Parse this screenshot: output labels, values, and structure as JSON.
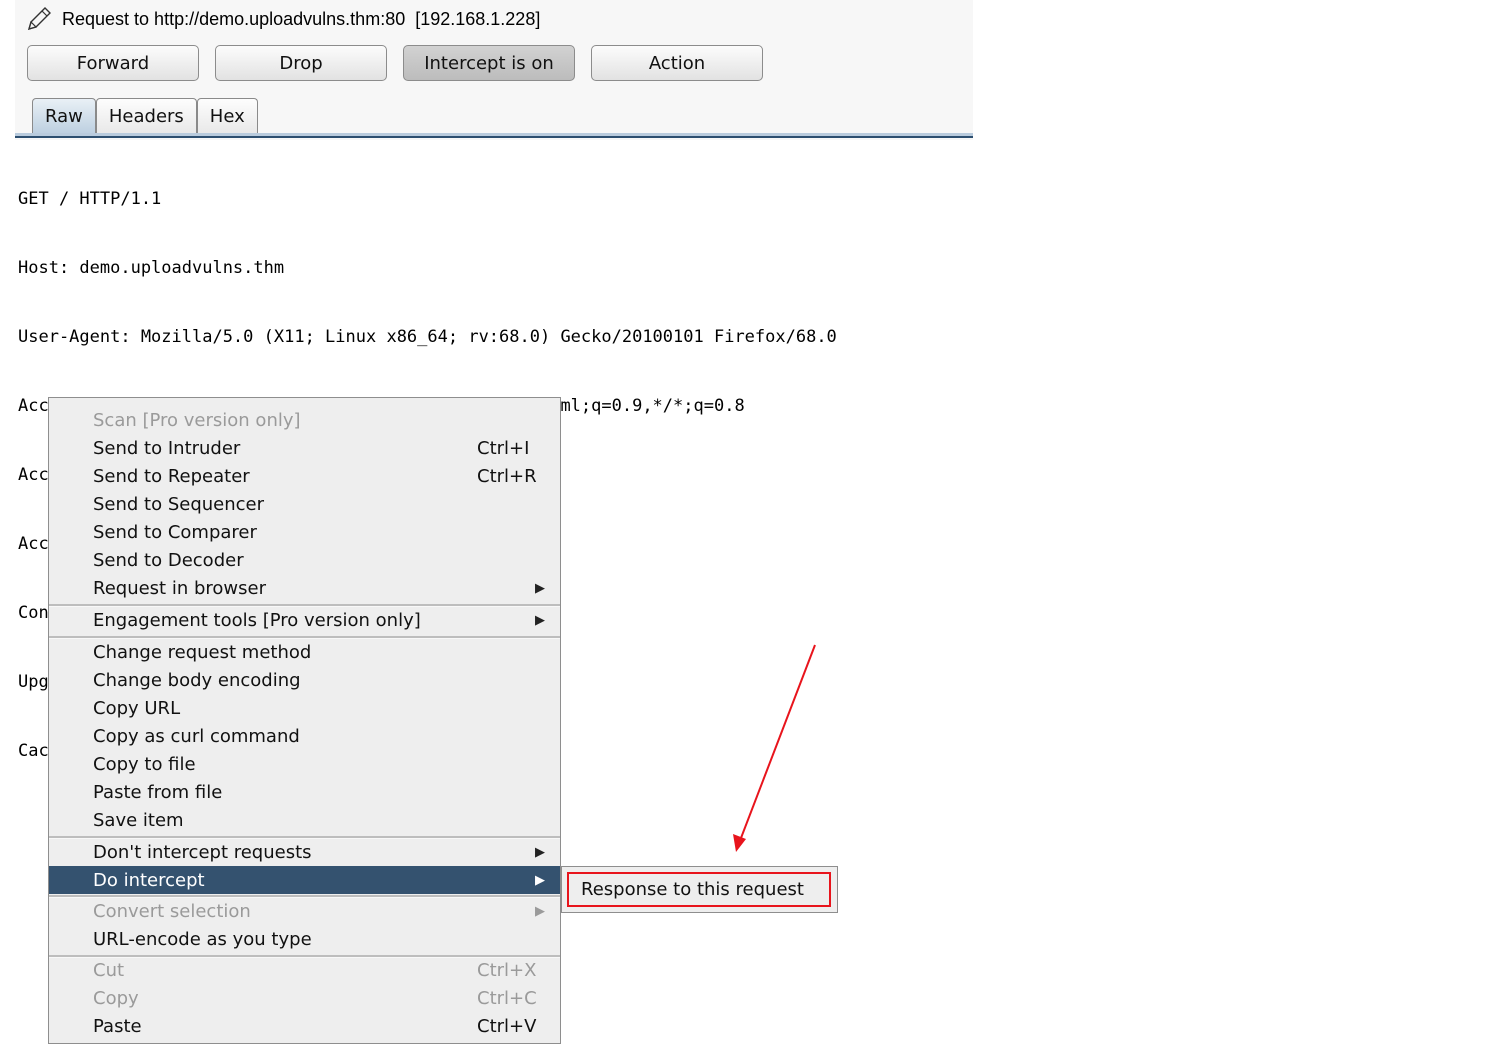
{
  "window": {
    "title": "Request to http://demo.uploadvulns.thm:80  [192.168.1.228]",
    "edit_icon": "pencil-icon"
  },
  "toolbar": {
    "forward": "Forward",
    "drop": "Drop",
    "intercept": "Intercept is on",
    "action": "Action"
  },
  "tabs": [
    {
      "label": "Raw",
      "selected": true
    },
    {
      "label": "Headers"
    },
    {
      "label": "Hex"
    }
  ],
  "request_lines": [
    "GET / HTTP/1.1",
    "Host: demo.uploadvulns.thm",
    "User-Agent: Mozilla/5.0 (X11; Linux x86_64; rv:68.0) Gecko/20100101 Firefox/68.0",
    "Accept: text/html,application/xhtml+xml,application/xml;q=0.9,*/*;q=0.8",
    "Accept-Language: en-US,en;q=0.5",
    "Accept-Encoding: gzip, deflate",
    "Connection: close",
    "Upgrade-Insecure-Requests: 1",
    "Cache-Control: max-age=0"
  ],
  "context_menu": {
    "items": [
      {
        "label": "Scan [Pro version only]",
        "disabled": true
      },
      {
        "label": "Send to Intruder",
        "shortcut": "Ctrl+I"
      },
      {
        "label": "Send to Repeater",
        "shortcut": "Ctrl+R"
      },
      {
        "label": "Send to Sequencer"
      },
      {
        "label": "Send to Comparer"
      },
      {
        "label": "Send to Decoder"
      },
      {
        "label": "Request in browser",
        "submenu": true
      },
      {
        "label": "Engagement tools [Pro version only]",
        "submenu": true
      },
      {
        "label": "Change request method"
      },
      {
        "label": "Change body encoding"
      },
      {
        "label": "Copy URL"
      },
      {
        "label": "Copy as curl command"
      },
      {
        "label": "Copy to file"
      },
      {
        "label": "Paste from file"
      },
      {
        "label": "Save item"
      },
      {
        "label": "Don't intercept requests",
        "submenu": true
      },
      {
        "label": "Do intercept",
        "submenu": true,
        "highlighted": true
      },
      {
        "label": "Convert selection",
        "submenu": true,
        "disabled": true
      },
      {
        "label": "URL-encode as you type"
      },
      {
        "label": "Cut",
        "shortcut": "Ctrl+X",
        "disabled": true
      },
      {
        "label": "Copy",
        "shortcut": "Ctrl+C",
        "disabled": true
      },
      {
        "label": "Paste",
        "shortcut": "Ctrl+V"
      }
    ],
    "submenu_arrow": "▶"
  },
  "submenu": {
    "item": "Response to this request"
  },
  "colors": {
    "highlight": "#34526f",
    "annotation": "#e8141c"
  }
}
